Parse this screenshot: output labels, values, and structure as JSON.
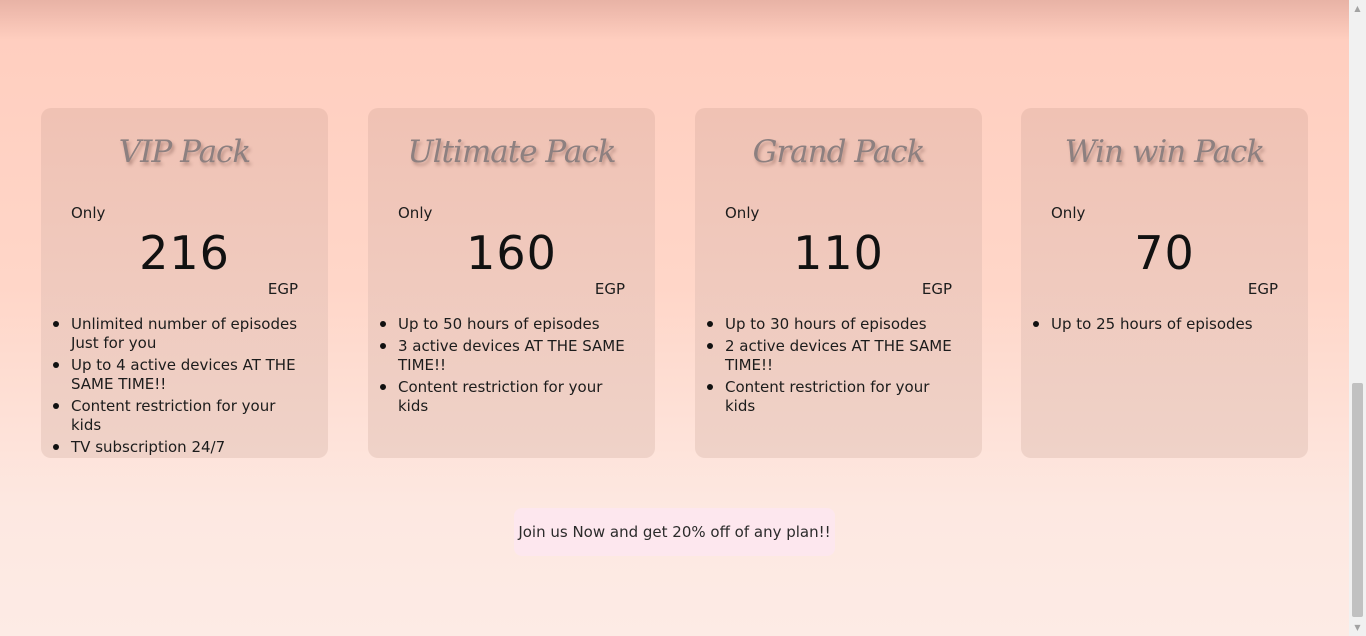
{
  "plans": [
    {
      "title": "VIP Pack",
      "price_prefix": "Only",
      "price": "216",
      "currency": "EGP",
      "features": [
        "Unlimited number of episodes Just for you",
        "Up to 4 active devices AT THE SAME TIME!!",
        "Content restriction for your kids",
        "TV subscription 24/7"
      ]
    },
    {
      "title": "Ultimate Pack",
      "price_prefix": "Only",
      "price": "160",
      "currency": "EGP",
      "features": [
        "Up to 50 hours of episodes",
        "3 active devices AT THE SAME TIME!!",
        "Content restriction for your kids"
      ]
    },
    {
      "title": "Grand Pack",
      "price_prefix": "Only",
      "price": "110",
      "currency": "EGP",
      "features": [
        "Up to 30 hours of episodes",
        "2 active devices AT THE SAME TIME!!",
        "Content restriction for your kids"
      ]
    },
    {
      "title": "Win win Pack",
      "price_prefix": "Only",
      "price": "70",
      "currency": "EGP",
      "features": [
        "Up to 25 hours of episodes"
      ]
    }
  ],
  "cta": {
    "label": "Join us Now and get 20% off of any plan!!"
  },
  "scrollbar": {
    "up_icon": "scroll-up-arrow-icon",
    "down_icon": "scroll-down-arrow-icon"
  },
  "colors": {
    "page_top": "#ffcdbe",
    "page_bottom": "#fdebe5",
    "card": "#f0c2b4",
    "title_text": "#8d8080",
    "cta_bg": "#fde7ee"
  }
}
